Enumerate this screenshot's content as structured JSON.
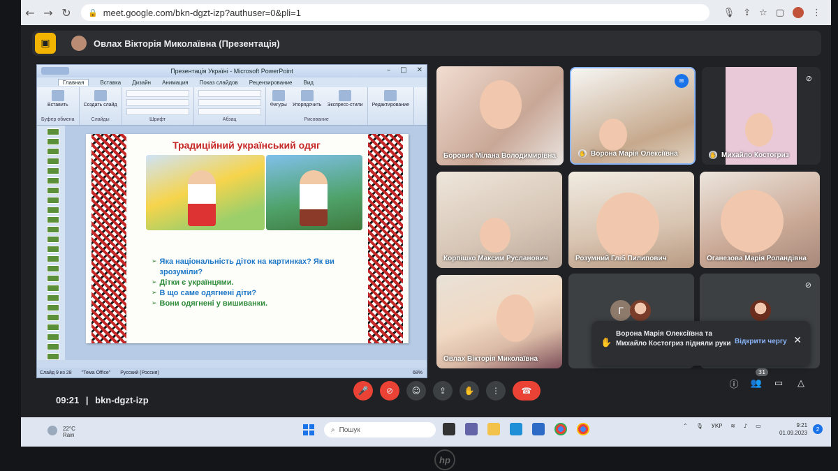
{
  "browser": {
    "url": "meet.google.com/bkn-dgzt-izp?authuser=0&pli=1",
    "back": "←",
    "forward": "→",
    "reload": "↻"
  },
  "presenter_bar": {
    "name": "Овлах Вікторія Миколаївна (Презентація)"
  },
  "ppt": {
    "window_title": "Презентація Україні - Microsoft PowerPoint",
    "tabs": [
      "Главная",
      "Вставка",
      "Дизайн",
      "Анимация",
      "Показ слайдов",
      "Рецензирование",
      "Вид"
    ],
    "ribbon": {
      "paste": "Вставить",
      "new_slide": "Создать слайд",
      "shapes": "Фигуры",
      "arrange": "Упорядочить",
      "express_styles": "Экспресс-стили",
      "edit": "Редактирование",
      "group_clipboard": "Буфер обмена",
      "group_slides": "Слайды",
      "group_font": "Шрифт",
      "group_paragraph": "Абзац",
      "group_drawing": "Рисование"
    },
    "slide": {
      "title": "Традиційний український одяг",
      "bullets": [
        "Яка національність діток на картинках? Як ви зрозуміли?",
        "Дітки є українцями.",
        "В що саме одягнені діти?",
        "Вони одягнені у вишиванки."
      ]
    },
    "status": {
      "slide_counter": "Слайд 9 из 28",
      "theme": "\"Тема Office\"",
      "language": "Русский (Россия)",
      "zoom": "68%"
    }
  },
  "participants": [
    {
      "name": "Боровик Мілана Володимирівна"
    },
    {
      "name": "Ворона Марія Олексіївна"
    },
    {
      "name": "Михайло Костогриз"
    },
    {
      "name": "Корпішко Максим Русланович"
    },
    {
      "name": "Розумний Гліб Пилипович"
    },
    {
      "name": "Оганезова Марія Роландівна"
    },
    {
      "name": "Овлах Вікторія Миколаївна"
    },
    {
      "avatar_letter": "Г"
    }
  ],
  "toast": {
    "message": "Ворона Марія Олексіївна та Михайло Костогриз підняли руки",
    "action": "Відкрити чергу"
  },
  "meeting": {
    "time": "09:21",
    "code": "bkn-dgzt-izp",
    "participant_count": "31"
  },
  "taskbar": {
    "temp": "22°C",
    "weather": "Rain",
    "search_placeholder": "Пошук",
    "lang": "УКР",
    "time": "9:21",
    "date": "01.09.2023",
    "notifications": "2"
  },
  "colors": {
    "meet_bg": "#202124",
    "end_call": "#ea4335",
    "accent_blue": "#8ab4f8",
    "slide_title_red": "#c62828",
    "bullet_blue": "#1e78c8",
    "bullet_green": "#2e8b3a"
  }
}
